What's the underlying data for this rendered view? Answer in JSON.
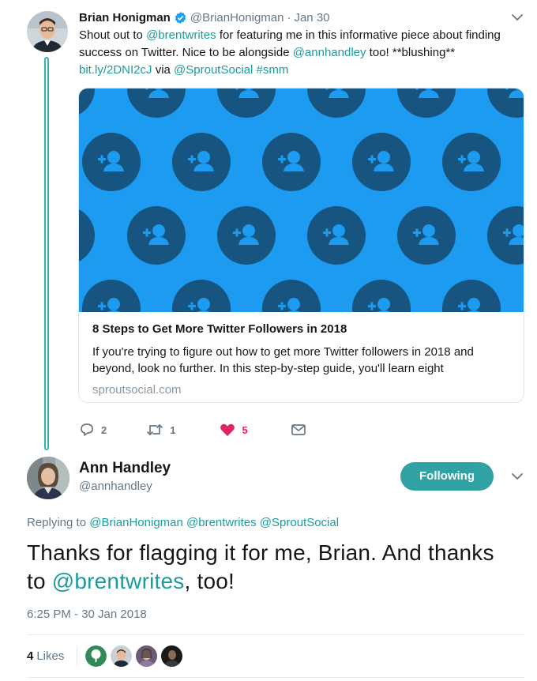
{
  "colors": {
    "accent": "#1a9b9c",
    "follow_button": "#31a2a3",
    "card_background": "#1d9bf0",
    "card_circle": "#17547f",
    "heart": "#e0245e",
    "muted": "#657786"
  },
  "tweet1": {
    "author_name": "Brian Honigman",
    "handle": "@BrianHonigman",
    "separator": "·",
    "date": "Jan 30",
    "verified_icon": "verified-badge-icon",
    "text": {
      "p1": "Shout out to ",
      "m1": "@brentwrites",
      "p2": " for featuring me in this informative piece about finding success on Twitter. Nice to be alongside ",
      "m2": "@annhandley",
      "p3": " too! **blushing** ",
      "link": "bit.ly/2DNI2cJ",
      "p4": " via ",
      "m3": "@SproutSocial",
      "p5": " ",
      "tag": "#smm"
    },
    "card": {
      "image_icon": "add-user-icon",
      "title": "8 Steps to Get More Twitter Followers in 2018",
      "description": "If you're trying to figure out how to get more Twitter followers in 2018 and beyond, look no further. In this step-by-step guide, you'll learn eight",
      "domain": "sproutsocial.com"
    },
    "actions": {
      "reply_count": "2",
      "retweet_count": "1",
      "like_count": "5"
    }
  },
  "tweet2": {
    "author_name": "Ann Handley",
    "handle": "@annhandley",
    "follow_label": "Following",
    "replying": {
      "prefix": "Replying to ",
      "m1": "@BrianHonigman",
      "m2": "@brentwrites",
      "m3": "@SproutSocial"
    },
    "text": {
      "p1": "Thanks for flagging it for me, Brian. And thanks to ",
      "m1": "@brentwrites",
      "p2": ", too!"
    },
    "timestamp": "6:25 PM - 30 Jan 2018",
    "likes_count": "4",
    "likes_label": "Likes"
  }
}
